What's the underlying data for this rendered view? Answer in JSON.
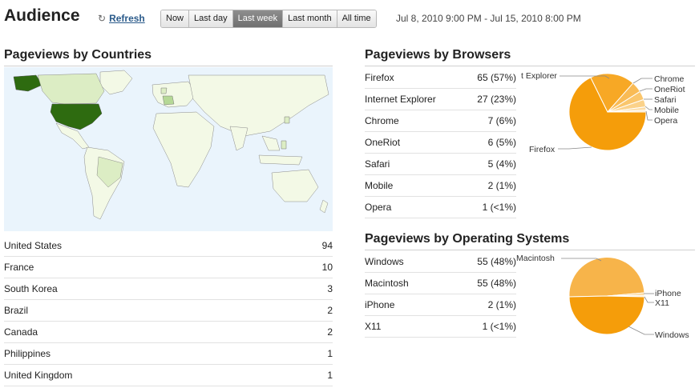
{
  "header": {
    "title": "Audience",
    "refresh_label": "Refresh",
    "time_buttons": [
      "Now",
      "Last day",
      "Last week",
      "Last month",
      "All time"
    ],
    "active_button": "Last week",
    "date_range": "Jul 8, 2010 9:00 PM - Jul 15, 2010 8:00 PM"
  },
  "countries": {
    "title": "Pageviews by Countries",
    "rows": [
      {
        "name": "United States",
        "value": "94"
      },
      {
        "name": "France",
        "value": "10"
      },
      {
        "name": "South Korea",
        "value": "3"
      },
      {
        "name": "Brazil",
        "value": "2"
      },
      {
        "name": "Canada",
        "value": "2"
      },
      {
        "name": "Philippines",
        "value": "1"
      },
      {
        "name": "United Kingdom",
        "value": "1"
      }
    ]
  },
  "browsers": {
    "title": "Pageviews by Browsers",
    "rows": [
      {
        "name": "Firefox",
        "value": "65 (57%)"
      },
      {
        "name": "Internet Explorer",
        "value": "27 (23%)"
      },
      {
        "name": "Chrome",
        "value": "7 (6%)"
      },
      {
        "name": "OneRiot",
        "value": "6 (5%)"
      },
      {
        "name": "Safari",
        "value": "5 (4%)"
      },
      {
        "name": "Mobile",
        "value": "2 (1%)"
      },
      {
        "name": "Opera",
        "value": "1 (<1%)"
      }
    ],
    "pie_labels": [
      "t Explorer",
      "Chrome",
      "OneRiot",
      "Safari",
      "Mobile",
      "Opera",
      "Firefox"
    ]
  },
  "os": {
    "title": "Pageviews by Operating Systems",
    "rows": [
      {
        "name": "Windows",
        "value": "55 (48%)"
      },
      {
        "name": "Macintosh",
        "value": "55 (48%)"
      },
      {
        "name": "iPhone",
        "value": "2 (1%)"
      },
      {
        "name": "X11",
        "value": "1 (<1%)"
      }
    ],
    "pie_labels": [
      "Macintosh",
      "iPhone",
      "X11",
      "Windows"
    ]
  },
  "colors": {
    "pie_main": "#f59d0a",
    "pie_second": "#f7b44a",
    "map_ocean": "#eaf4fc",
    "map_land": "#f3f9e6",
    "map_high": "#2e6b10"
  }
}
